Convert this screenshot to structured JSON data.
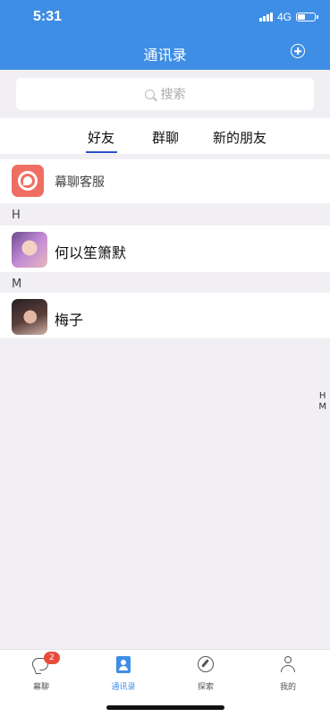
{
  "status": {
    "time": "5:31",
    "network": "4G"
  },
  "header": {
    "title": "通讯录"
  },
  "search": {
    "placeholder": "搜索"
  },
  "tabs": [
    {
      "label": "好友",
      "active": true
    },
    {
      "label": "群聊"
    },
    {
      "label": "新的朋友"
    }
  ],
  "service": {
    "name": "幕聊客服"
  },
  "sections": [
    {
      "letter": "H",
      "contacts": [
        {
          "name": "何以笙箫默"
        }
      ]
    },
    {
      "letter": "M",
      "contacts": [
        {
          "name": "梅子"
        }
      ]
    }
  ],
  "index_letters": [
    "H",
    "M"
  ],
  "tabbar": {
    "items": [
      {
        "label": "幕聊",
        "icon": "chat-icon",
        "badge": "2"
      },
      {
        "label": "通讯录",
        "icon": "contacts-icon",
        "active": true
      },
      {
        "label": "探索",
        "icon": "compass-icon"
      },
      {
        "label": "我的",
        "icon": "user-icon"
      }
    ]
  },
  "colors": {
    "primary": "#3f8ee5",
    "badge": "#e94b3c",
    "tab_indicator": "#2c4fc9"
  }
}
